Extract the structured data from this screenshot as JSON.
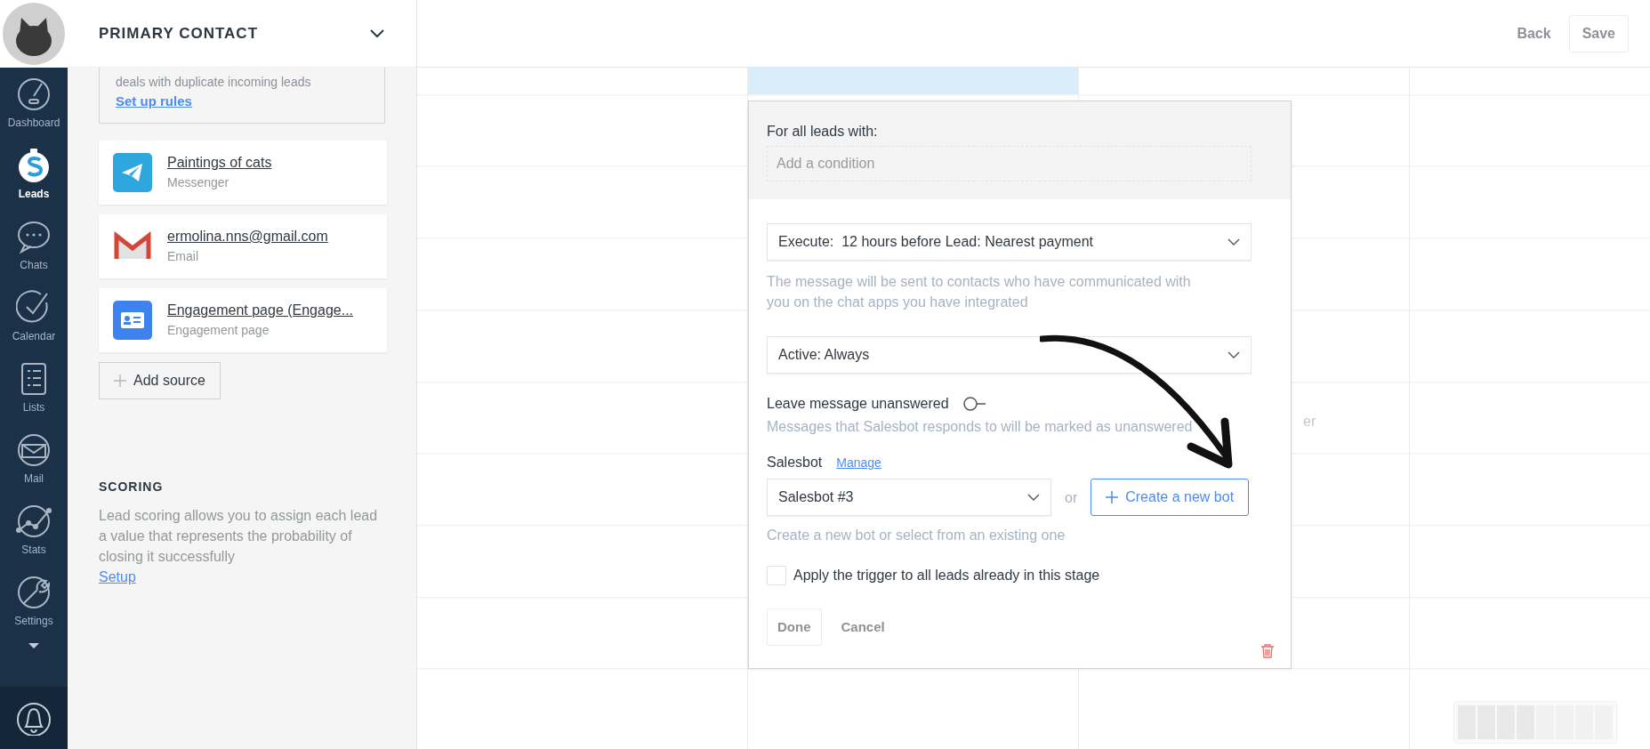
{
  "sidebar": {
    "items": [
      {
        "label": "Dashboard",
        "selected": false
      },
      {
        "label": "Leads",
        "selected": true
      },
      {
        "label": "Chats",
        "selected": false
      },
      {
        "label": "Calendar",
        "selected": false
      },
      {
        "label": "Lists",
        "selected": false
      },
      {
        "label": "Mail",
        "selected": false
      },
      {
        "label": "Stats",
        "selected": false
      },
      {
        "label": "Settings",
        "selected": false
      }
    ]
  },
  "panel": {
    "title": "PRIMARY CONTACT",
    "duplicates": {
      "text": "deals with duplicate incoming leads",
      "link": "Set up rules"
    },
    "sources": [
      {
        "name": "Paintings of cats",
        "type": "Messenger",
        "kind": "telegram"
      },
      {
        "name": "ermolina.nns@gmail.com",
        "type": "Email",
        "kind": "gmail"
      },
      {
        "name": "Engagement page (Engage...",
        "type": "Engagement page",
        "kind": "page"
      }
    ],
    "add_source": "Add source",
    "scoring": {
      "title": "SCORING",
      "text": "Lead scoring allows you to assign each lead a value that represents the probability of closing it successfully",
      "link": "Setup"
    }
  },
  "toolbar": {
    "back": "Back",
    "save": "Save"
  },
  "board": {
    "note": "er"
  },
  "popup": {
    "condition_label": "For all leads with:",
    "condition_placeholder": "Add a condition",
    "execute": "Execute:  12 hours before Lead: Nearest payment",
    "execute_hint": "The message will be sent to contacts who have communicated with you on the chat apps you have integrated",
    "active": "Active: Always",
    "unanswered": {
      "label": "Leave message unanswered",
      "on": false
    },
    "unanswered_hint": "Messages that Salesbot responds to will be marked as unanswered",
    "salesbot_label": "Salesbot",
    "manage": "Manage",
    "salesbot": "Salesbot #3",
    "or": "or",
    "create": "Create a new bot",
    "salesbot_hint": "Create a new bot or select from an existing one",
    "apply": {
      "label": "Apply the trigger to all leads already in this stage",
      "checked": false
    },
    "done": "Done",
    "cancel": "Cancel"
  }
}
